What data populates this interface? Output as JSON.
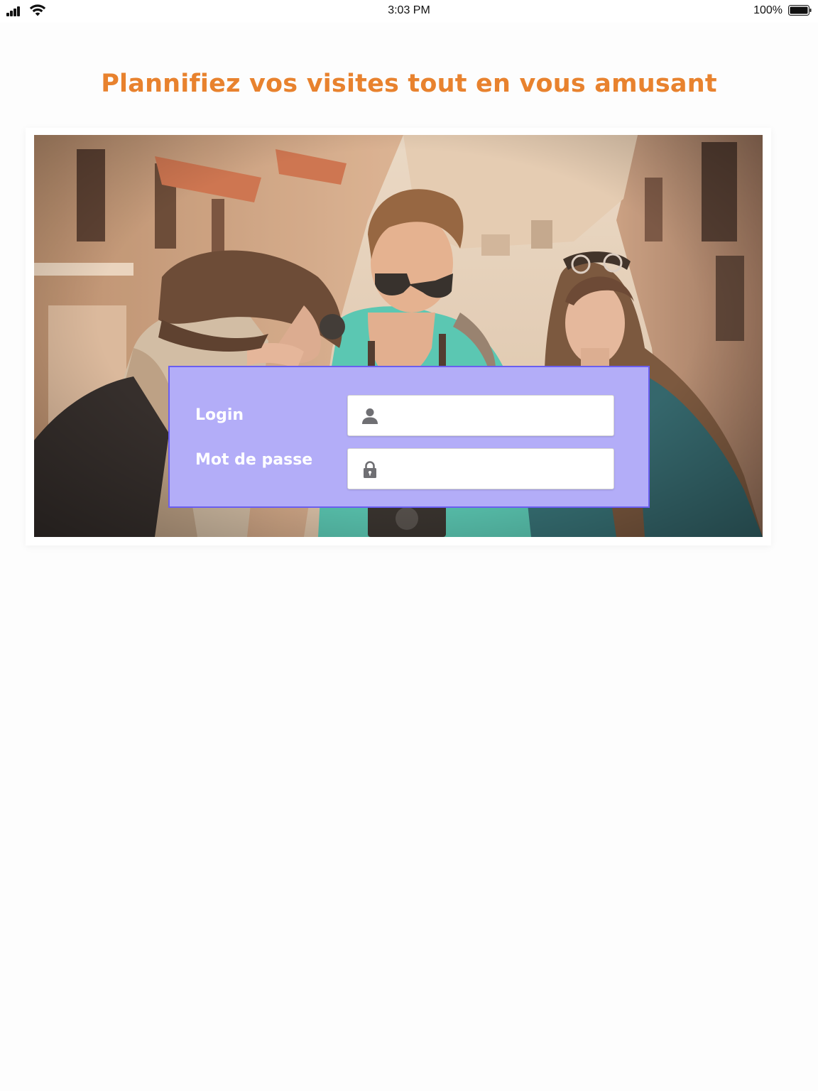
{
  "status_bar": {
    "time": "3:03 PM",
    "battery_percent": "100%",
    "icons": [
      "signal-icon",
      "wifi-icon",
      "battery-icon"
    ]
  },
  "page": {
    "title": "Plannifiez vos visites tout en vous amusant",
    "title_color": "#e8822e"
  },
  "hero": {
    "image": "photo-of-three-young-tourists-in-old-town-street"
  },
  "login_form": {
    "background_color": "#b3adf8",
    "border_color": "#6a5ef0",
    "login_label": "Login",
    "login_value": "",
    "login_icon": "user-icon",
    "password_label": "Mot de passe",
    "password_value": "",
    "password_icon": "lock-icon"
  }
}
